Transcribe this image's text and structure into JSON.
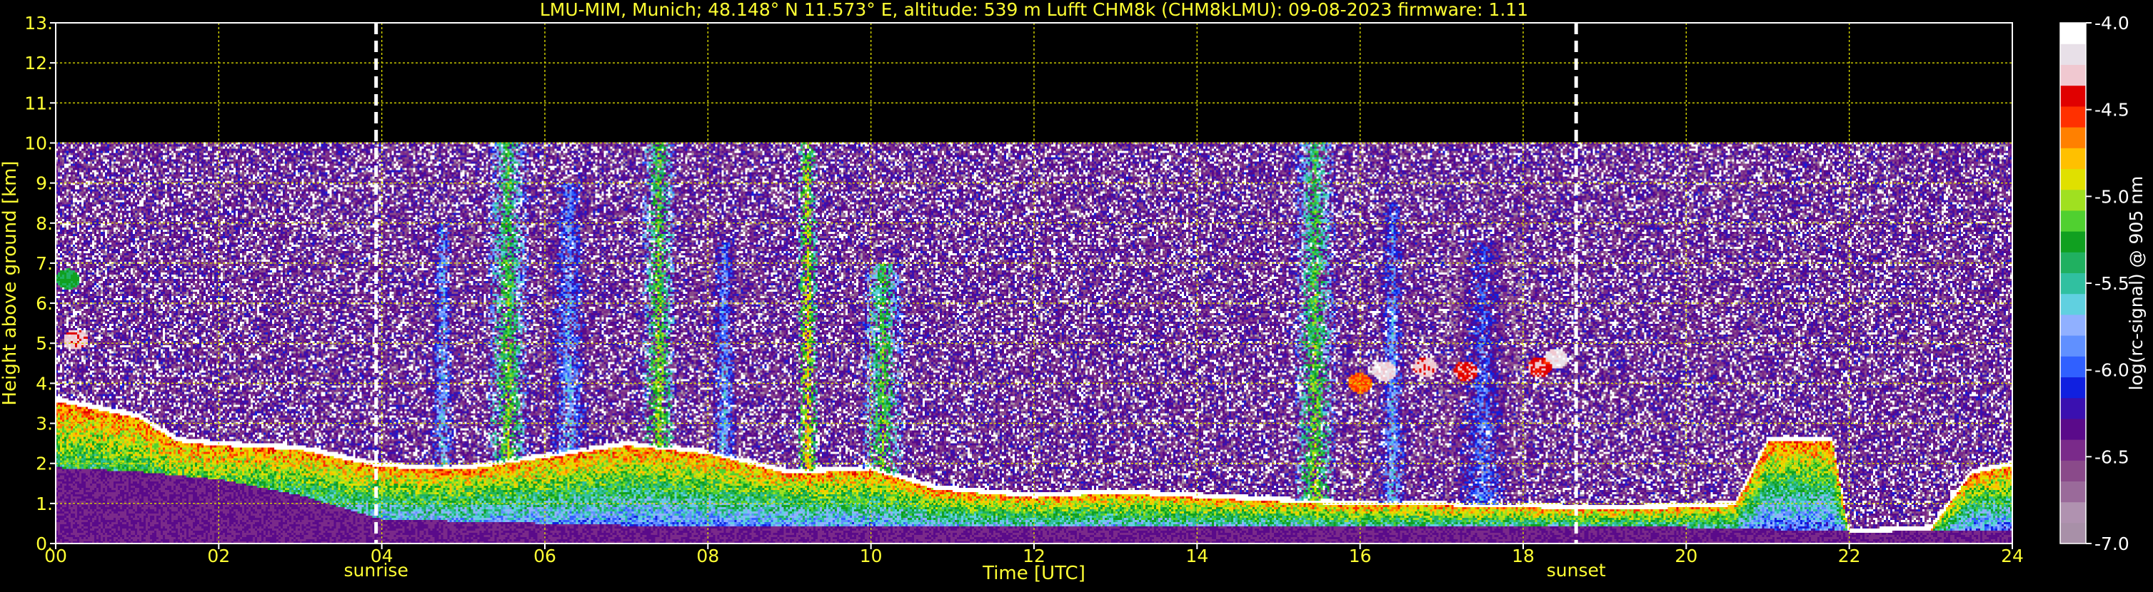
{
  "title": "LMU-MIM, Munich; 48.148° N 11.573° E, altitude: 539 m    Lufft CHM8k (CHM8kLMU): 09-08-2023    firmware: 1.11",
  "colors": {
    "text": "#ffff33",
    "axis": "#ffffff",
    "grid": "#d8d800",
    "background": "#000000",
    "colorbar_label": "#ffffff"
  },
  "chart_data": {
    "type": "heatmap",
    "xlabel": "Time [UTC]",
    "ylabel": "Height above ground [km]",
    "xlim": [
      0,
      24
    ],
    "ylim": [
      0,
      13
    ],
    "x_ticks": [
      "00",
      "02",
      "04",
      "06",
      "08",
      "10",
      "12",
      "14",
      "16",
      "18",
      "20",
      "22",
      "24"
    ],
    "y_ticks": [
      "0.",
      "1.",
      "2.",
      "3.",
      "4.",
      "5.",
      "6.",
      "7.",
      "8.",
      "9.",
      "10.",
      "11.",
      "12.",
      "13."
    ],
    "grid": true,
    "data_top_km": 10,
    "sunrise_utc": 3.93,
    "sunset_utc": 18.65,
    "annotations": [
      "sunrise",
      "sunset"
    ],
    "colorbar": {
      "label": "log(rc-signal) @ 905 nm",
      "range": [
        -7.0,
        -4.0
      ],
      "ticks": [
        "-4.0",
        "-4.5",
        "-5.0",
        "-5.5",
        "-6.0",
        "-6.5",
        "-7.0"
      ],
      "colors": [
        "#a890a8",
        "#b092b0",
        "#9a6a9a",
        "#8a4a8a",
        "#7a2a8a",
        "#5a0a8a",
        "#3a10b0",
        "#1020e0",
        "#3060ff",
        "#6090ff",
        "#90b0ff",
        "#60d0e0",
        "#30c0a0",
        "#20b060",
        "#10a020",
        "#50d030",
        "#a0e020",
        "#e0e000",
        "#ffc000",
        "#ff8000",
        "#ff3000",
        "#e00000",
        "#f0c8d0",
        "#e8e0e8",
        "#ffffff"
      ]
    },
    "layers": {
      "pbl_top_km": [
        [
          0,
          3.6
        ],
        [
          1,
          3.2
        ],
        [
          1.5,
          2.6
        ],
        [
          2,
          2.5
        ],
        [
          3,
          2.4
        ],
        [
          3.9,
          2.0
        ],
        [
          4.5,
          1.9
        ],
        [
          5,
          1.9
        ],
        [
          6,
          2.2
        ],
        [
          7,
          2.5
        ],
        [
          8,
          2.3
        ],
        [
          9,
          1.8
        ],
        [
          10,
          1.9
        ],
        [
          10.8,
          1.4
        ],
        [
          12,
          1.2
        ],
        [
          13,
          1.3
        ],
        [
          14,
          1.2
        ],
        [
          15,
          1.1
        ],
        [
          16,
          1.0
        ],
        [
          17,
          1.0
        ],
        [
          18,
          0.95
        ],
        [
          19,
          0.9
        ],
        [
          20,
          0.95
        ],
        [
          20.6,
          1.0
        ],
        [
          21,
          2.6
        ],
        [
          21.8,
          2.6
        ],
        [
          22,
          0.3
        ],
        [
          23,
          0.4
        ],
        [
          23.5,
          1.8
        ],
        [
          24,
          2.0
        ]
      ],
      "residual_layer_km": [
        [
          0,
          1.9
        ],
        [
          1,
          1.8
        ],
        [
          2,
          1.6
        ],
        [
          3,
          1.2
        ],
        [
          4,
          0.6
        ],
        [
          6,
          0.5
        ],
        [
          8,
          0.4
        ],
        [
          10,
          0.4
        ],
        [
          12,
          0.4
        ],
        [
          14,
          0.4
        ],
        [
          16,
          0.4
        ],
        [
          18,
          0.4
        ],
        [
          20,
          0.4
        ],
        [
          22,
          0.3
        ],
        [
          24,
          0.3
        ]
      ],
      "cloud_patches": [
        {
          "t": 0.25,
          "h": 5.1,
          "v": -4.3
        },
        {
          "t": 0.15,
          "h": 6.6,
          "v": -5.3
        },
        {
          "t": 16.3,
          "h": 4.3,
          "v": -4.2
        },
        {
          "t": 16.8,
          "h": 4.4,
          "v": -4.3
        },
        {
          "t": 17.3,
          "h": 4.3,
          "v": -4.4
        },
        {
          "t": 18.4,
          "h": 4.6,
          "v": -4.2
        },
        {
          "t": 18.2,
          "h": 4.4,
          "v": -4.4
        },
        {
          "t": 16.0,
          "h": 4.0,
          "v": -4.6
        }
      ],
      "plumes": [
        {
          "t0": 4.6,
          "t1": 4.9,
          "hmax": 8.0,
          "v": -5.5
        },
        {
          "t0": 5.3,
          "t1": 5.8,
          "hmax": 10.0,
          "v": -5.0
        },
        {
          "t0": 6.0,
          "t1": 6.6,
          "hmax": 9.0,
          "v": -5.6
        },
        {
          "t0": 7.2,
          "t1": 7.6,
          "hmax": 10.0,
          "v": -4.9
        },
        {
          "t0": 8.0,
          "t1": 8.4,
          "hmax": 7.5,
          "v": -5.6
        },
        {
          "t0": 9.1,
          "t1": 9.35,
          "hmax": 10.0,
          "v": -4.7
        },
        {
          "t0": 9.9,
          "t1": 10.4,
          "hmax": 7.0,
          "v": -5.0
        },
        {
          "t0": 15.2,
          "t1": 15.7,
          "hmax": 10.0,
          "v": -5.0
        },
        {
          "t0": 16.2,
          "t1": 16.6,
          "hmax": 8.5,
          "v": -5.6
        },
        {
          "t0": 17.0,
          "t1": 18.0,
          "hmax": 7.5,
          "v": -5.8
        }
      ]
    }
  }
}
